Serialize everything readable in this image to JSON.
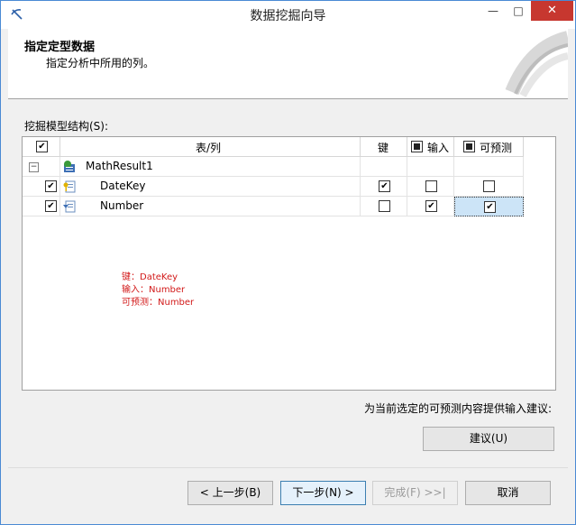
{
  "window": {
    "title": "数据挖掘向导",
    "minimize": "—",
    "maximize": "□",
    "close": "✕"
  },
  "header": {
    "title": "指定定型数据",
    "subtitle": "指定分析中所用的列。"
  },
  "structure_label": "挖掘模型结构(S):",
  "grid": {
    "columns": {
      "table_col": "表/列",
      "key": "键",
      "input": "输入",
      "predict": "可预测"
    },
    "rows": [
      {
        "name": "MathResult1",
        "type": "table",
        "selected": null,
        "key": null,
        "input": null,
        "predict": null
      },
      {
        "name": "DateKey",
        "type": "column-key",
        "selected": true,
        "key": true,
        "input": false,
        "predict": false
      },
      {
        "name": "Number",
        "type": "column",
        "selected": true,
        "key": false,
        "input": true,
        "predict": true
      }
    ]
  },
  "annotations": [
    "键：DateKey",
    "输入：Number",
    "可预测：Number"
  ],
  "suggest": {
    "hint": "为当前选定的可预测内容提供输入建议:",
    "button": "建议(U)"
  },
  "nav": {
    "back": "< 上一步(B)",
    "next": "下一步(N) >",
    "finish": "完成(F) >>|",
    "cancel": "取消"
  }
}
